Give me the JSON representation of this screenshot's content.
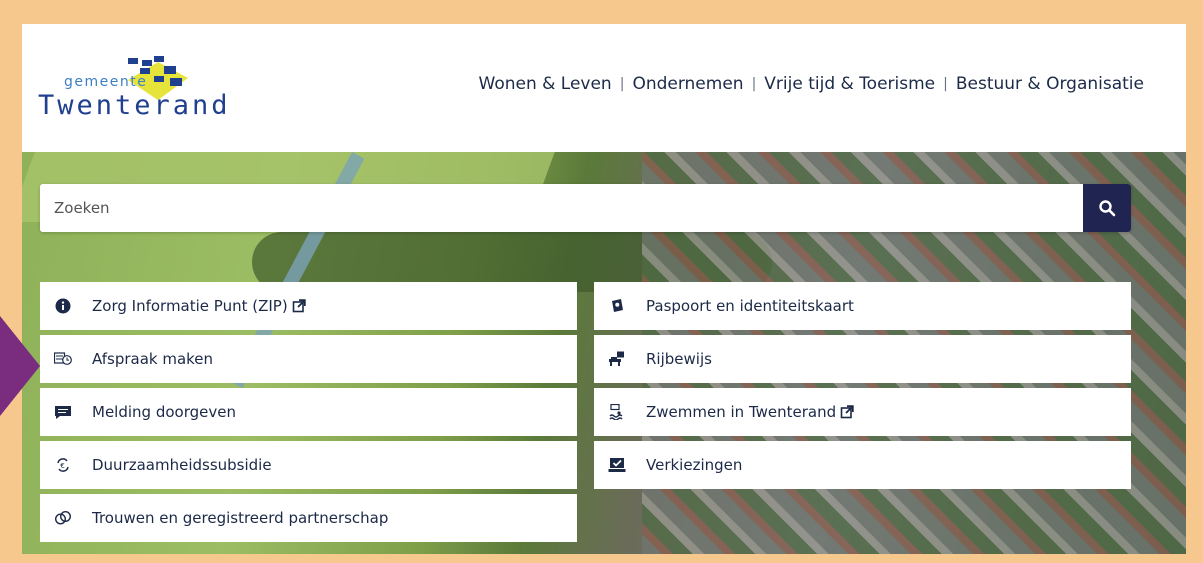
{
  "logo": {
    "small": "gemeente",
    "big": "Twenterand"
  },
  "nav": [
    {
      "label": "Wonen & Leven"
    },
    {
      "label": "Ondernemen"
    },
    {
      "label": "Vrije tijd & Toerisme"
    },
    {
      "label": "Bestuur & Organisatie"
    }
  ],
  "search": {
    "placeholder": "Zoeken",
    "icon": "search-icon"
  },
  "tiles_left": [
    {
      "label": "Zorg Informatie Punt (ZIP)",
      "icon": "info-icon",
      "external": true
    },
    {
      "label": "Afspraak maken",
      "icon": "calendar-clock-icon",
      "external": false
    },
    {
      "label": "Melding doorgeven",
      "icon": "message-icon",
      "external": false
    },
    {
      "label": "Duurzaamheidssubsidie",
      "icon": "recycle-euro-icon",
      "external": false
    },
    {
      "label": "Trouwen en geregistreerd partnerschap",
      "icon": "rings-icon",
      "external": false
    }
  ],
  "tiles_right": [
    {
      "label": "Paspoort en identiteitskaart",
      "icon": "passport-icon",
      "external": false
    },
    {
      "label": "Rijbewijs",
      "icon": "driving-icon",
      "external": false
    },
    {
      "label": "Zwemmen in Twenterand",
      "icon": "swimming-icon",
      "external": true
    },
    {
      "label": "Verkiezingen",
      "icon": "ballot-icon",
      "external": false
    }
  ],
  "colors": {
    "border": "#f6c88e",
    "navy": "#1f2451",
    "text": "#1c2a48",
    "accent_arrow": "#7a2d7f"
  }
}
